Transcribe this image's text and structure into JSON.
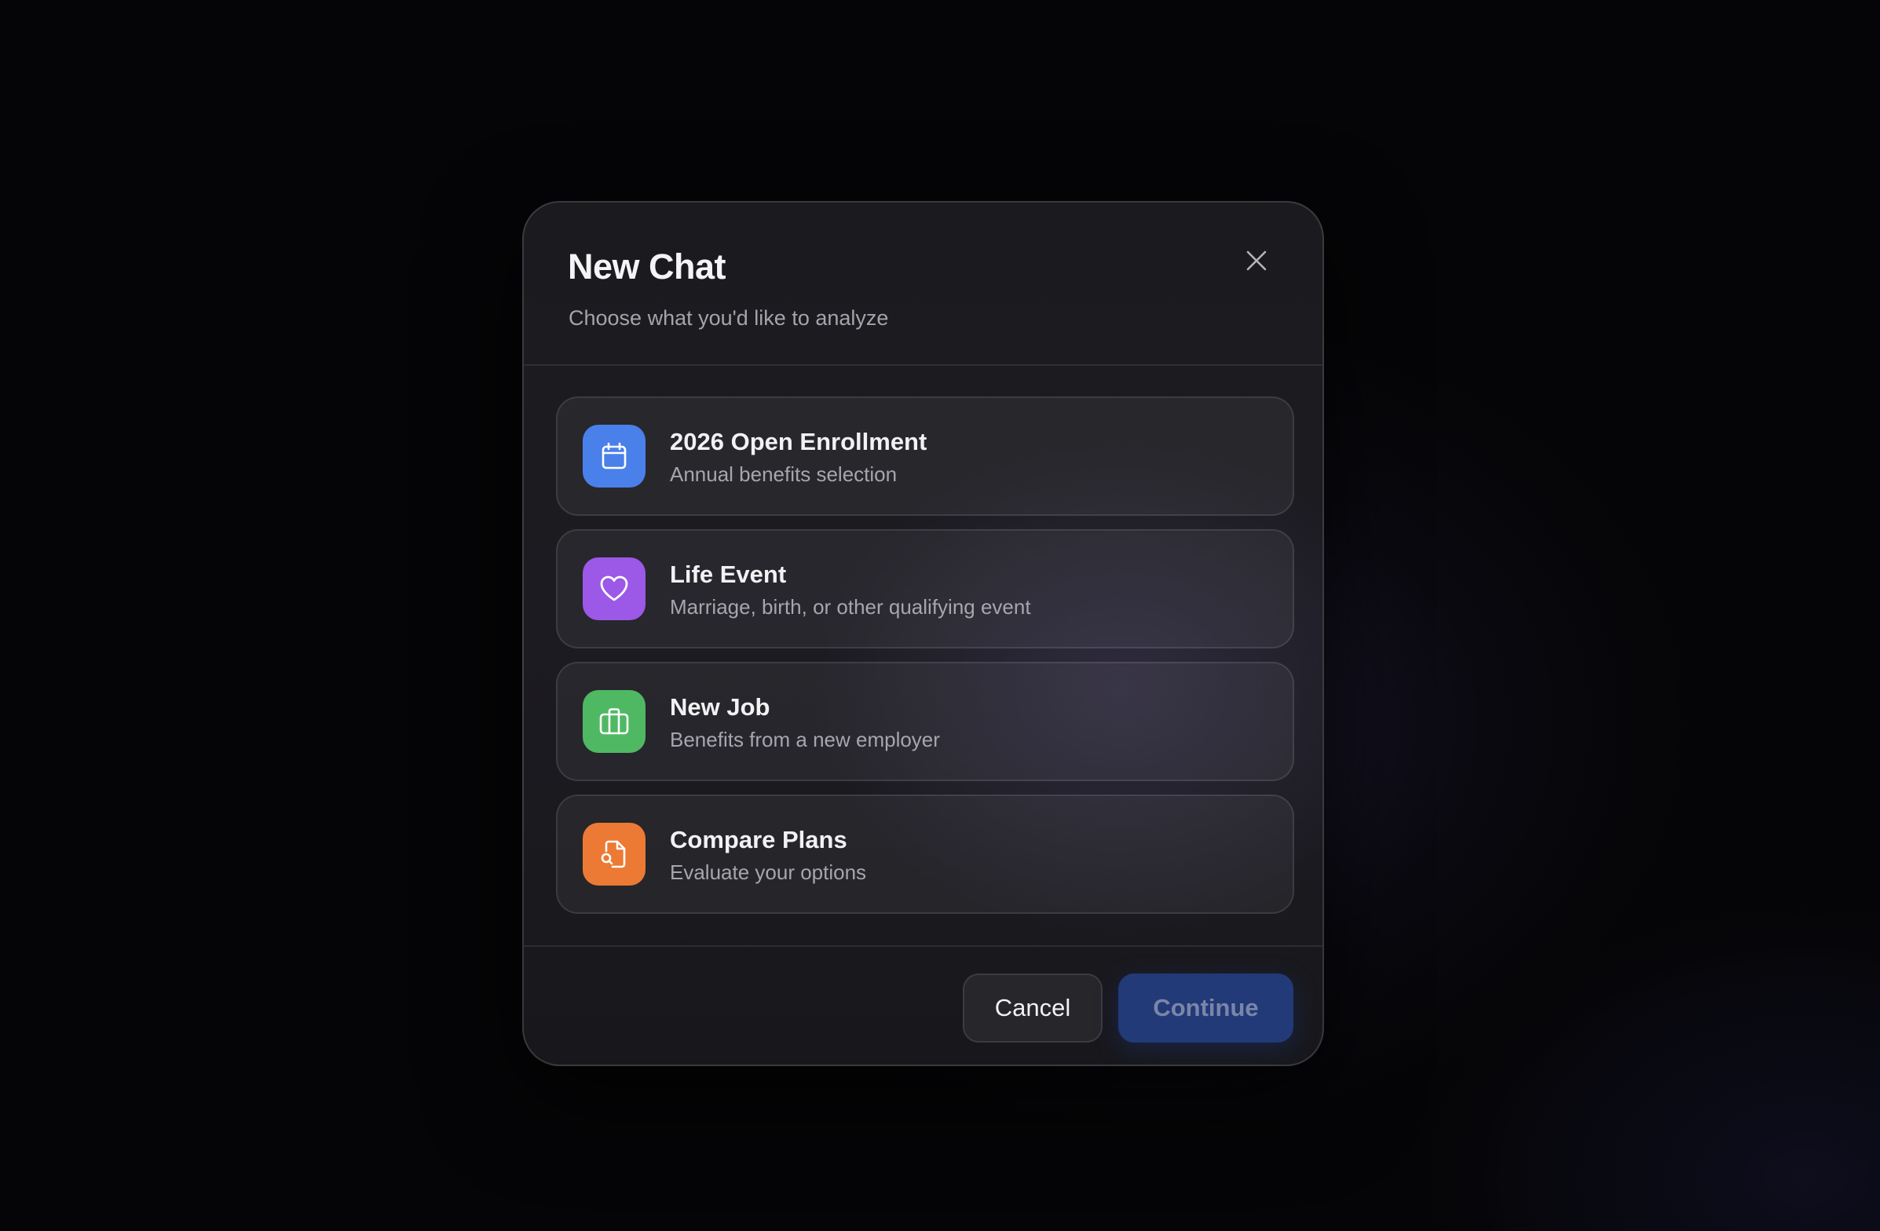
{
  "dialog": {
    "title": "New Chat",
    "subtitle": "Choose what you'd like to analyze",
    "close_icon": "close-icon"
  },
  "options": [
    {
      "title": "2026 Open Enrollment",
      "description": "Annual benefits selection",
      "icon": "calendar-icon",
      "color": "#4a80ea"
    },
    {
      "title": "Life Event",
      "description": "Marriage, birth, or other qualifying event",
      "icon": "heart-icon",
      "color": "#9c58e6"
    },
    {
      "title": "New Job",
      "description": "Benefits from a new employer",
      "icon": "briefcase-icon",
      "color": "#4fb863"
    },
    {
      "title": "Compare Plans",
      "description": "Evaluate your options",
      "icon": "file-search-icon",
      "color": "#ec7a34"
    }
  ],
  "footer": {
    "cancel_label": "Cancel",
    "continue_label": "Continue"
  },
  "colors": {
    "background": "#050507",
    "modal": "#1b1b1f",
    "continue_button": "#233a78"
  }
}
